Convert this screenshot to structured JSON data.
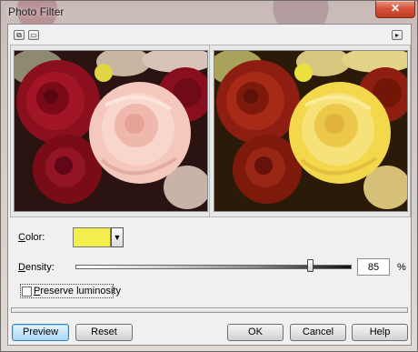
{
  "window": {
    "title": "Photo Filter",
    "close_glyph": "✕"
  },
  "toolbar": {
    "left_icons": [
      "split-view-icon",
      "single-view-icon"
    ],
    "right_icon": "expand-arrow-icon"
  },
  "previews": {
    "before": "original-roses-image",
    "after": "filtered-roses-image"
  },
  "color": {
    "label_underlined": "C",
    "label_rest": "olor:",
    "value": "#f2ee4d",
    "dropdown_glyph": "▼"
  },
  "density": {
    "label_underlined": "D",
    "label_rest": "ensity:",
    "value": "85",
    "unit": "%",
    "fraction": 0.85
  },
  "preserve": {
    "label_underlined": "P",
    "label_rest": "reserve luminosity",
    "checked": false
  },
  "buttons": {
    "preview": "Preview",
    "reset": "Reset",
    "ok": "OK",
    "cancel": "Cancel",
    "help": "Help"
  },
  "colors": {
    "filter": "#f2ee4d",
    "close": "#c9432a",
    "default_button": "#a9d6f7"
  }
}
